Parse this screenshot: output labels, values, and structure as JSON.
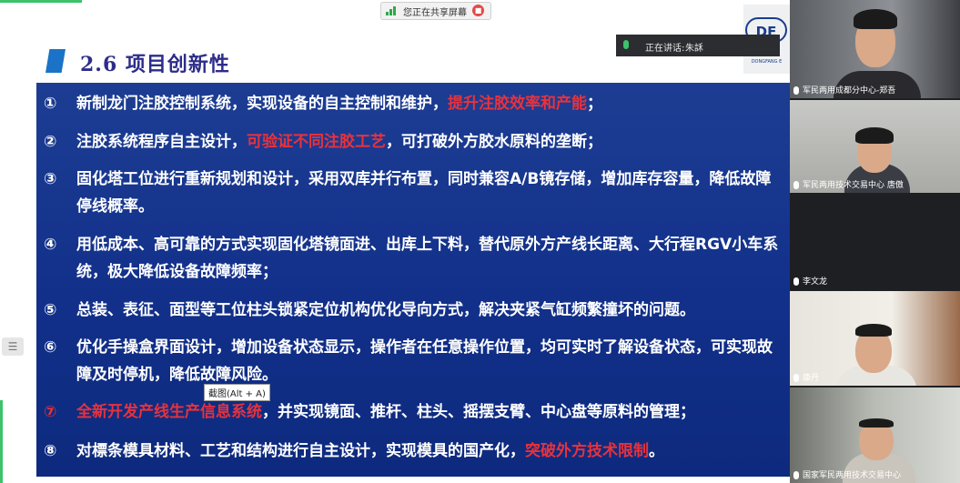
{
  "share_bar": {
    "label": "您正在共享屏幕"
  },
  "speaking": {
    "label": "正在讲话:",
    "name": "朱訸"
  },
  "slide": {
    "title": "2.6 项目创新性",
    "logo_text": "DE",
    "logo_sub": "DONGFANG E",
    "items": [
      {
        "num": "①",
        "parts": [
          "新制龙门注胶控制系统，实现设备的自主控制和维护，",
          "提升注胶效率和产能",
          "；"
        ]
      },
      {
        "num": "②",
        "parts": [
          "注胶系统程序自主设计，",
          "可验证不同注胶工艺",
          "，可打破外方胶水原料的垄断；"
        ]
      },
      {
        "num": "③",
        "text": "固化塔工位进行重新规划和设计，采用双库并行布置，同时兼容A/B镜存储，增加库存容量，降低故障停线概率。"
      },
      {
        "num": "④",
        "text": "用低成本、高可靠的方式实现固化塔镜面进、出库上下料，替代原外方产线长距离、大行程RGV小车系统，极大降低设备故障频率；"
      },
      {
        "num": "⑤",
        "text": "总装、表征、面型等工位柱头锁紧定位机构优化导向方式，解决夹紧气缸频繁撞坏的问题。"
      },
      {
        "num": "⑥",
        "text": "优化手操盒界面设计，增加设备状态显示，操作者在任意操作位置，均可实时了解设备状态，可实现故障及时停机，降低故障风险。"
      },
      {
        "num": "⑦",
        "parts": [
          "全新开发产线生产信息系统",
          "，并实现镜面、推杆、柱头、摇摆支臂、中心盘等原料的管理；"
        ]
      },
      {
        "num": "⑧",
        "parts": [
          "对標条模具材料、工艺和结构进行自主设计，实现模具的国产化，",
          "突破外方技术限制",
          "。"
        ]
      }
    ]
  },
  "tooltip": {
    "text": "截图(Alt + A)"
  },
  "menu_icon": "☰",
  "participants": [
    {
      "name": "军民两用成都分中心-郑吾"
    },
    {
      "name": "军民两用技术交易中心 唐傲"
    },
    {
      "name": "李文龙"
    },
    {
      "name": "康丹"
    },
    {
      "name": "国家军民两用技术交易中心"
    }
  ],
  "colors": {
    "panel": "#12308a",
    "highlight": "#e8323c",
    "title": "#2d2d8a"
  }
}
